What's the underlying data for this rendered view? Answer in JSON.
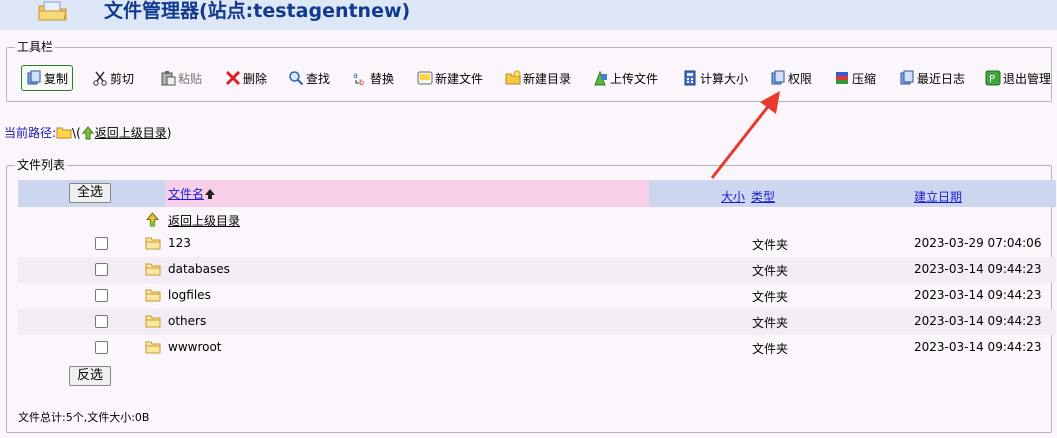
{
  "header": {
    "title": "文件管理器(站点:testagentnew)"
  },
  "toolbar": {
    "legend": "工具栏",
    "buttons": [
      {
        "label": "复制",
        "icon": "copy-icon"
      },
      {
        "label": "剪切",
        "icon": "cut-icon"
      },
      {
        "label": "粘贴",
        "icon": "paste-icon"
      },
      {
        "label": "删除",
        "icon": "delete-icon"
      },
      {
        "label": "查找",
        "icon": "search-icon"
      },
      {
        "label": "替换",
        "icon": "replace-icon"
      },
      {
        "label": "新建文件",
        "icon": "new-file-icon"
      },
      {
        "label": "新建目录",
        "icon": "new-folder-icon"
      },
      {
        "label": "上传文件",
        "icon": "upload-icon"
      },
      {
        "label": "计算大小",
        "icon": "calc-size-icon"
      },
      {
        "label": "权限",
        "icon": "permission-icon"
      },
      {
        "label": "压缩",
        "icon": "compress-icon"
      },
      {
        "label": "最近日志",
        "icon": "log-icon"
      },
      {
        "label": "退出管理",
        "icon": "exit-icon"
      }
    ]
  },
  "path": {
    "label": "当前路径:",
    "separator": "\\(",
    "up_link": "返回上级目录",
    "close": ")"
  },
  "file_list": {
    "legend": "文件列表",
    "select_all": "全选",
    "invert_select": "反选",
    "columns": {
      "name": "文件名",
      "size": "大小",
      "type": "类型",
      "date": "建立日期"
    },
    "up_row": "返回上级目录",
    "rows": [
      {
        "name": "123",
        "type": "文件夹",
        "date": "2023-03-29 07:04:06"
      },
      {
        "name": "databases",
        "type": "文件夹",
        "date": "2023-03-14 09:44:23"
      },
      {
        "name": "logfiles",
        "type": "文件夹",
        "date": "2023-03-14 09:44:23"
      },
      {
        "name": "others",
        "type": "文件夹",
        "date": "2023-03-14 09:44:23"
      },
      {
        "name": "wwwroot",
        "type": "文件夹",
        "date": "2023-03-14 09:44:23"
      }
    ],
    "summary": "文件总计:5个,文件大小:0B"
  },
  "colors": {
    "header_bg": "#dde7f7",
    "title": "#113a8f",
    "annotation_arrow": "#e8392e",
    "name_header_bg": "#f7cfe9"
  }
}
